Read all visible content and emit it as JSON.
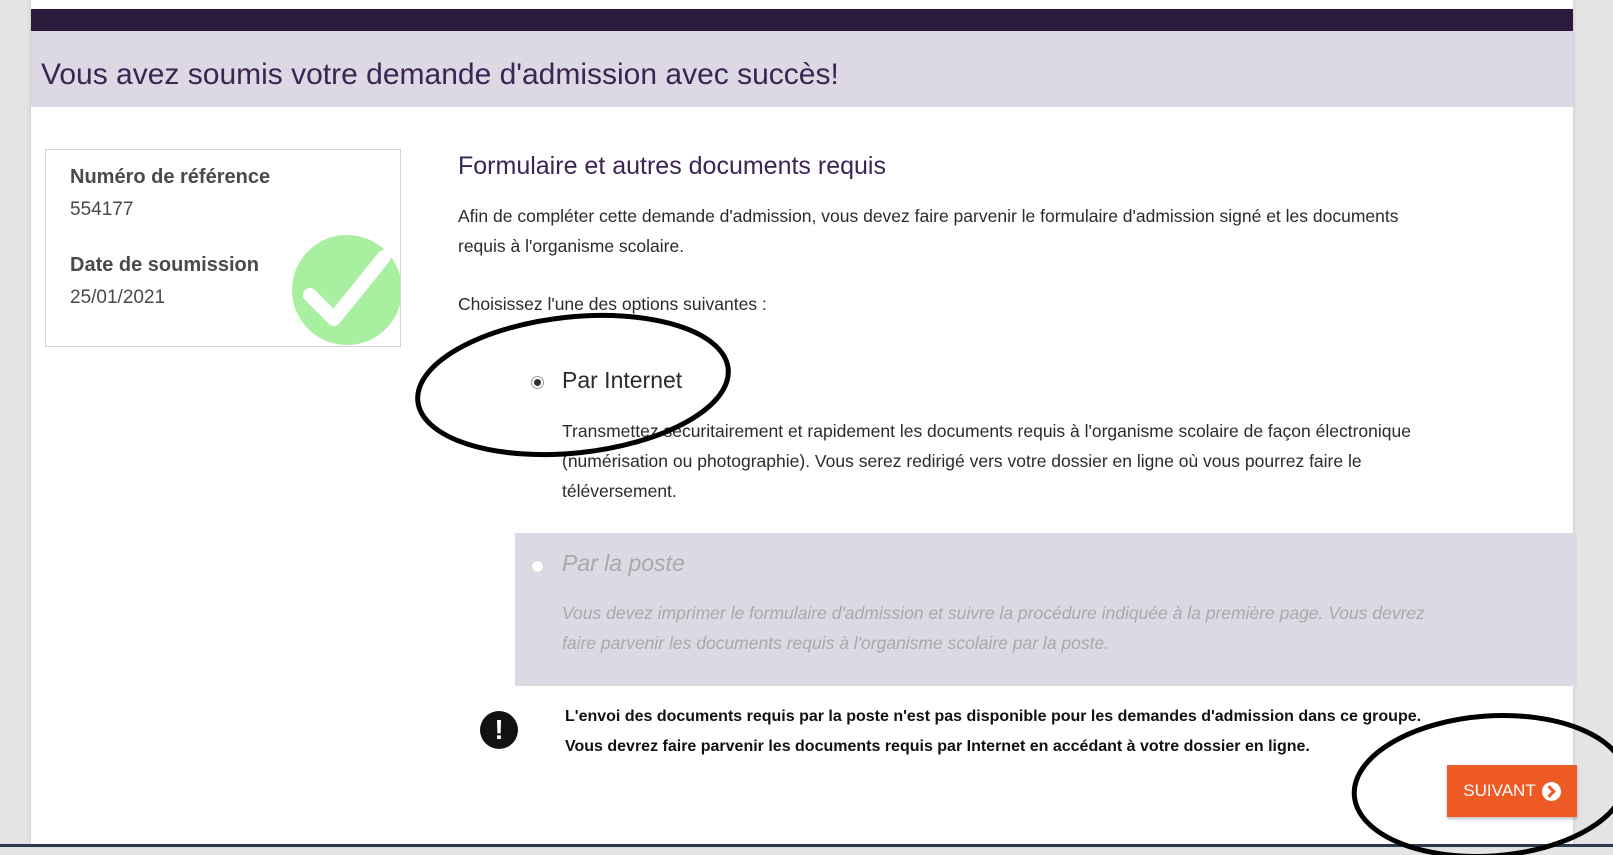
{
  "header": {
    "title": "Vous avez soumis votre demande d'admission avec succès!"
  },
  "reference": {
    "number_label": "Numéro de référence",
    "number_value": "554177",
    "date_label": "Date de soumission",
    "date_value": "25/01/2021"
  },
  "main": {
    "section_title": "Formulaire et autres documents requis",
    "intro_line1": "Afin de compléter cette demande d'admission, vous devez faire parvenir le formulaire d'admission signé et les documents",
    "intro_line2": "requis à l'organisme scolaire.",
    "choose_prompt": "Choisissez l'une des options suivantes :",
    "option_internet": {
      "label": "Par Internet",
      "selected": true,
      "desc_line1": "Transmettez sécuritairement et rapidement les documents requis à l'organisme scolaire de façon électronique",
      "desc_line2": "(numérisation ou photographie). Vous serez redirigé vers votre dossier en ligne où vous pourrez faire le",
      "desc_line3": "téléversement."
    },
    "option_poste": {
      "label": "Par la poste",
      "selected": false,
      "disabled": true,
      "desc_line1": "Vous devez imprimer le formulaire d'admission et suivre la procédure indiquée à la première page. Vous devrez",
      "desc_line2": "faire parvenir les documents requis à l'organisme scolaire par la poste."
    },
    "warning": {
      "icon": "exclamation-icon",
      "line1": "L'envoi des documents requis par la poste n'est pas disponible pour les demandes d'admission dans ce groupe.",
      "line2": "Vous devrez faire parvenir les documents requis par Internet en accédant à votre dossier en ligne."
    },
    "next_button": {
      "label": "SUIVANT",
      "icon": "chevron-circle-right-icon"
    }
  },
  "colors": {
    "header_dark": "#2a1b3d",
    "header_band": "#dcd9e4",
    "title_purple": "#3a2553",
    "accent_orange": "#ee5a24",
    "check_green": "#a8ef9f"
  }
}
